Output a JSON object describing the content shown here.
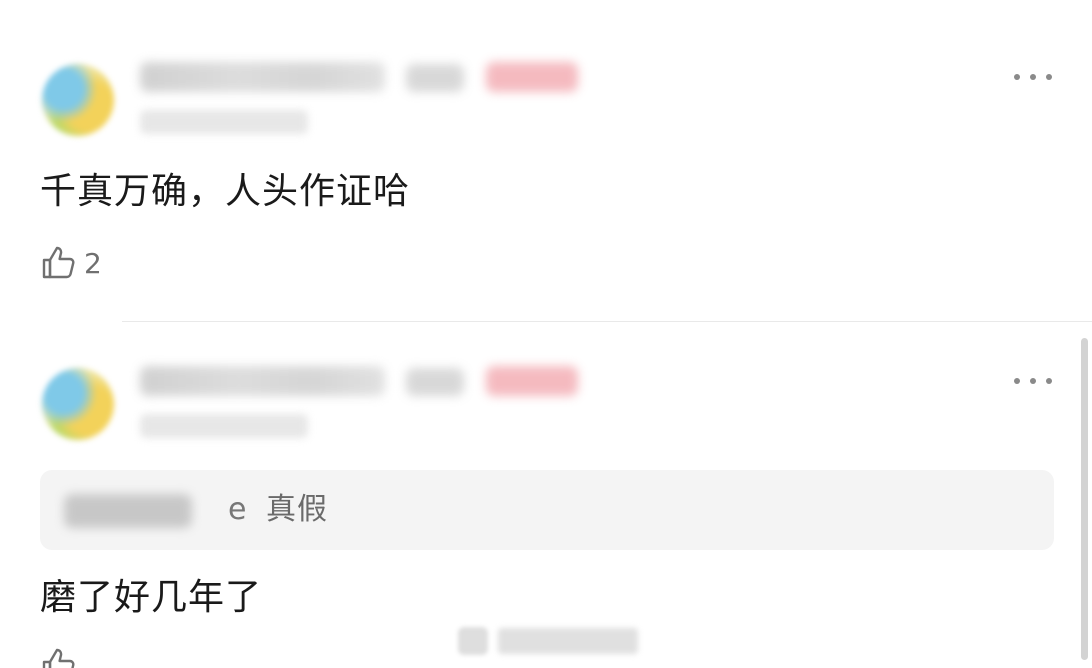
{
  "comments": [
    {
      "text": "千真万确，人头作证哈",
      "likes": "2"
    },
    {
      "quote": {
        "user_visible_tail": "e",
        "text": "真假"
      },
      "text": "磨了好几年了"
    }
  ],
  "icons": {
    "more": "more-horizontal-icon",
    "like": "thumbs-up-icon"
  },
  "colors": {
    "text": "#1a1a1a",
    "secondary": "#707070",
    "quote_bg": "#f4f4f4",
    "badge_blur": "#f4b3b9"
  }
}
